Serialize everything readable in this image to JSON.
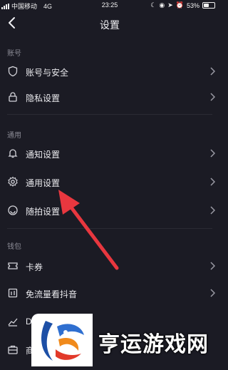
{
  "status_bar": {
    "carrier": "中国移动",
    "network": "4G",
    "time": "23:25",
    "battery": "53%",
    "battery_level": 0.53
  },
  "nav": {
    "title": "设置"
  },
  "sections": [
    {
      "label": "账号",
      "items": [
        {
          "label": "账号与安全",
          "icon": "shield-icon"
        },
        {
          "label": "隐私设置",
          "icon": "lock-icon"
        }
      ]
    },
    {
      "label": "通用",
      "items": [
        {
          "label": "通知设置",
          "icon": "bell-icon"
        },
        {
          "label": "通用设置",
          "icon": "gear-icon"
        },
        {
          "label": "随拍设置",
          "icon": "camera-icon"
        }
      ]
    },
    {
      "label": "钱包",
      "items": [
        {
          "label": "卡券",
          "icon": "ticket-icon"
        },
        {
          "label": "免流量看抖音",
          "icon": "data-icon"
        },
        {
          "label": "D",
          "icon": "chart-icon"
        },
        {
          "label": "商",
          "icon": "shop-icon"
        }
      ]
    }
  ],
  "watermark": {
    "text": "亨运游戏网"
  },
  "colors": {
    "background": "#1b1b24",
    "arrow": "#e8373f"
  }
}
